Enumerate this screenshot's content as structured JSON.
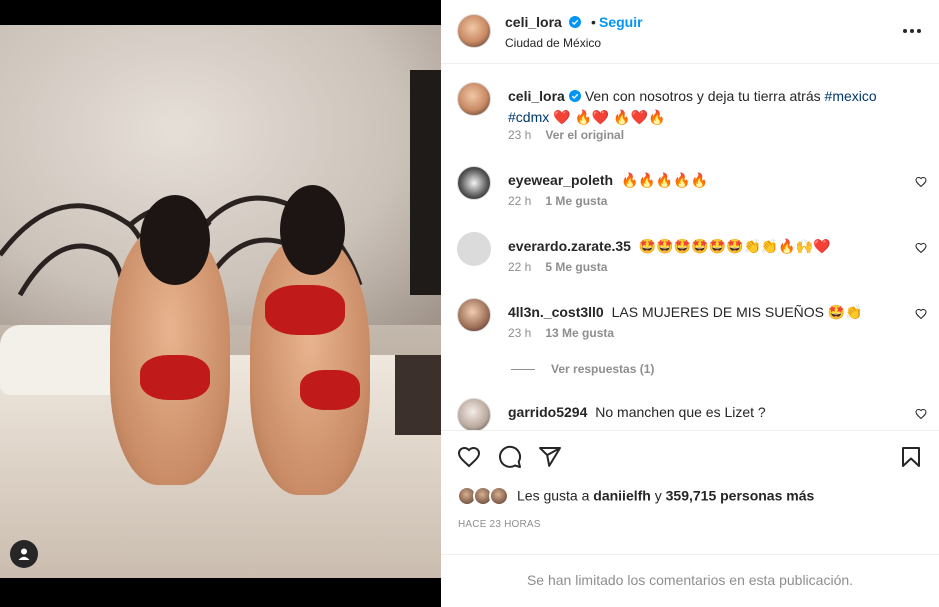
{
  "post": {
    "author": "celi_lora",
    "follow_label": "Seguir",
    "separator": "•",
    "location": "Ciudad de México",
    "caption_text": "Ven con nosotros y deja tu tierra atrás",
    "caption_tag1": "#mexico",
    "caption_tag2": "#cdmx",
    "caption_emojis": "❤️ 🔥❤️ 🔥❤️🔥",
    "caption_time": "23 h",
    "caption_action": "Ver el original"
  },
  "comments": [
    {
      "user": "eyewear_poleth",
      "text": "🔥🔥🔥🔥🔥",
      "time": "22 h",
      "likes": "1 Me gusta"
    },
    {
      "user": "everardo.zarate.35",
      "text": "🤩🤩🤩🤩🤩🤩👏👏🔥🙌❤️",
      "time": "22 h",
      "likes": "5 Me gusta"
    },
    {
      "user": "4ll3n._cost3ll0",
      "text": "LAS MUJERES DE MIS SUEÑOS 🤩👏",
      "time": "23 h",
      "likes": "13 Me gusta"
    },
    {
      "user": "garrido5294",
      "text": "No manchen que es Lizet ?"
    }
  ],
  "view_replies": "Ver respuestas (1)",
  "likes": {
    "prefix": "Les gusta a",
    "user": "daniielfh",
    "connector": "y",
    "count": "359,715 personas más"
  },
  "time_ago": "HACE 23 HORAS",
  "comments_limited": "Se han limitado los comentarios en esta publicación.",
  "colors": {
    "link": "#0095f6",
    "hashtag": "#00376b",
    "muted": "#8e8e8e",
    "text": "#262626"
  },
  "icons": [
    "verified-icon",
    "more-icon",
    "heart-icon",
    "comment-icon",
    "share-icon",
    "bookmark-icon",
    "user-tag-icon"
  ]
}
